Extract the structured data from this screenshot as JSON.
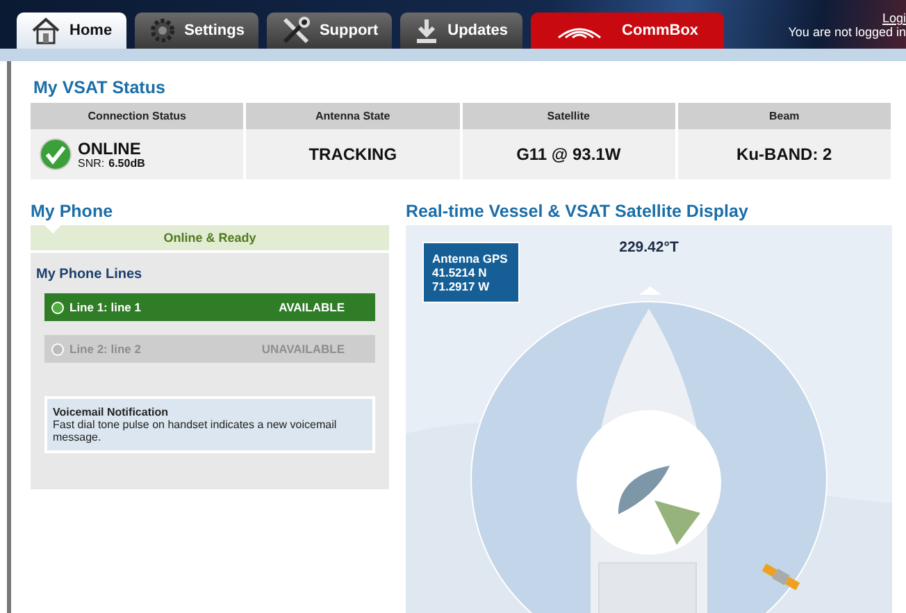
{
  "tabs": [
    {
      "label": "Home",
      "selected": true,
      "kind": "normal"
    },
    {
      "label": "Settings",
      "selected": false,
      "kind": "normal"
    },
    {
      "label": "Support",
      "selected": false,
      "kind": "normal"
    },
    {
      "label": "Updates",
      "selected": false,
      "kind": "normal"
    },
    {
      "label": "CommBox",
      "selected": false,
      "kind": "accent"
    }
  ],
  "account": {
    "link": "Logi",
    "message": "You are not logged in"
  },
  "vsat_status": {
    "title": "My VSAT Status",
    "columns": [
      "Connection Status",
      "Antenna State",
      "Satellite",
      "Beam"
    ],
    "connection": {
      "online": true,
      "state": "ONLINE",
      "snr_label": "SNR:",
      "snr_value": "6.50dB"
    },
    "antenna_state": "TRACKING",
    "satellite": "G11 @ 93.1W",
    "beam": "Ku-BAND: 2"
  },
  "phone": {
    "title": "My Phone",
    "status": "Online & Ready",
    "lines_title": "My Phone Lines",
    "lines": [
      {
        "name": "Line 1: line 1",
        "status": "AVAILABLE",
        "available": true
      },
      {
        "name": "Line 2: line 2",
        "status": "UNAVAILABLE",
        "available": false
      }
    ],
    "voicemail": {
      "title": "Voicemail Notification",
      "text": "Fast dial tone pulse on handset indicates a new voicemail message."
    }
  },
  "display": {
    "title": "Real-time Vessel & VSAT Satellite Display",
    "heading": "229.42°T",
    "gps": {
      "title": "Antenna GPS",
      "lat": "41.5214 N",
      "lon": "71.2917 W"
    }
  }
}
